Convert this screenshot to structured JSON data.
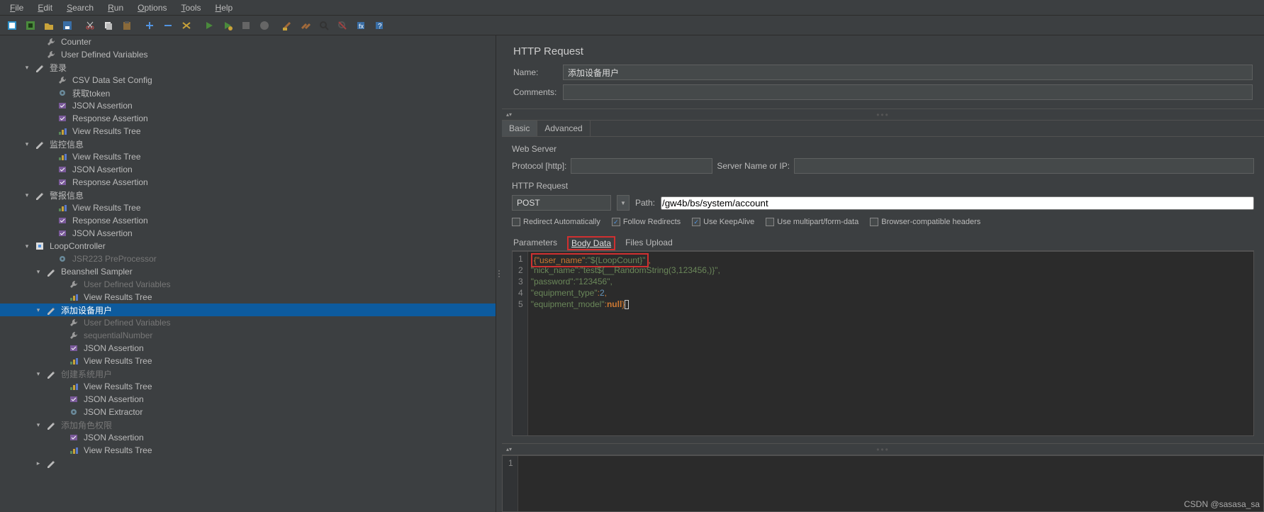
{
  "menu": {
    "items": [
      "File",
      "Edit",
      "Search",
      "Run",
      "Options",
      "Tools",
      "Help"
    ]
  },
  "toolbar_icons": [
    "new-test-plan",
    "template",
    "open",
    "save",
    "folder-open",
    "close",
    "",
    "cut",
    "copy",
    "paste",
    "",
    "plus",
    "minus",
    "wand",
    "",
    "run",
    "run-remote",
    "stop",
    "stop-all",
    "shutdown",
    "",
    "clear",
    "broom",
    "find",
    "log",
    "heap",
    "function",
    "help"
  ],
  "tree": [
    {
      "d": 3,
      "toggle": "",
      "icon": "wrench",
      "label": "Counter"
    },
    {
      "d": 3,
      "toggle": "",
      "icon": "wrench",
      "label": "User Defined Variables"
    },
    {
      "d": 2,
      "toggle": "▾",
      "icon": "pencil",
      "label": "登录"
    },
    {
      "d": 4,
      "toggle": "",
      "icon": "wrench",
      "label": "CSV Data Set Config"
    },
    {
      "d": 4,
      "toggle": "",
      "icon": "gear",
      "label": "获取token"
    },
    {
      "d": 4,
      "toggle": "",
      "icon": "assert",
      "label": "JSON Assertion"
    },
    {
      "d": 4,
      "toggle": "",
      "icon": "assert",
      "label": "Response Assertion"
    },
    {
      "d": 4,
      "toggle": "",
      "icon": "results",
      "label": "View Results Tree"
    },
    {
      "d": 2,
      "toggle": "▾",
      "icon": "pencil",
      "label": "监控信息"
    },
    {
      "d": 4,
      "toggle": "",
      "icon": "results",
      "label": "View Results Tree"
    },
    {
      "d": 4,
      "toggle": "",
      "icon": "assert",
      "label": "JSON Assertion"
    },
    {
      "d": 4,
      "toggle": "",
      "icon": "assert",
      "label": "Response Assertion"
    },
    {
      "d": 2,
      "toggle": "▾",
      "icon": "pencil",
      "label": "警报信息"
    },
    {
      "d": 4,
      "toggle": "",
      "icon": "results",
      "label": "View Results Tree"
    },
    {
      "d": 4,
      "toggle": "",
      "icon": "assert",
      "label": "Response Assertion"
    },
    {
      "d": 4,
      "toggle": "",
      "icon": "assert",
      "label": "JSON Assertion"
    },
    {
      "d": 2,
      "toggle": "▾",
      "icon": "loop",
      "label": "LoopController"
    },
    {
      "d": 4,
      "toggle": "",
      "icon": "gear",
      "label": "JSR223 PreProcessor",
      "dim": true
    },
    {
      "d": 3,
      "toggle": "▾",
      "icon": "pencil",
      "label": "Beanshell Sampler"
    },
    {
      "d": 5,
      "toggle": "",
      "icon": "wrench",
      "label": "User Defined Variables",
      "dim": true
    },
    {
      "d": 5,
      "toggle": "",
      "icon": "results",
      "label": "View Results Tree"
    },
    {
      "d": 3,
      "toggle": "▾",
      "icon": "pencil",
      "label": "添加设备用户",
      "selected": true
    },
    {
      "d": 5,
      "toggle": "",
      "icon": "wrench",
      "label": "User Defined Variables",
      "dim": true
    },
    {
      "d": 5,
      "toggle": "",
      "icon": "wrench",
      "label": "sequentialNumber",
      "dim": true
    },
    {
      "d": 5,
      "toggle": "",
      "icon": "assert",
      "label": "JSON Assertion"
    },
    {
      "d": 5,
      "toggle": "",
      "icon": "results",
      "label": "View Results Tree"
    },
    {
      "d": 3,
      "toggle": "▾",
      "icon": "pencil",
      "label": "创建系统用户",
      "dim": true
    },
    {
      "d": 5,
      "toggle": "",
      "icon": "results",
      "label": "View Results Tree"
    },
    {
      "d": 5,
      "toggle": "",
      "icon": "assert",
      "label": "JSON Assertion"
    },
    {
      "d": 5,
      "toggle": "",
      "icon": "gear",
      "label": "JSON Extractor"
    },
    {
      "d": 3,
      "toggle": "▾",
      "icon": "pencil",
      "label": "添加角色权限",
      "dim": true
    },
    {
      "d": 5,
      "toggle": "",
      "icon": "assert",
      "label": "JSON Assertion"
    },
    {
      "d": 5,
      "toggle": "",
      "icon": "results",
      "label": "View Results Tree"
    },
    {
      "d": 3,
      "toggle": "▸",
      "icon": "pencil",
      "label": "",
      "dim": true
    }
  ],
  "rp": {
    "title": "HTTP Request",
    "name_label": "Name:",
    "name_value": "添加设备用户",
    "comments_label": "Comments:",
    "comments_value": "",
    "tabs": {
      "basic": "Basic",
      "advanced": "Advanced"
    },
    "web_server_label": "Web Server",
    "protocol_label": "Protocol [http]:",
    "protocol_value": "",
    "server_label": "Server Name or IP:",
    "server_value": "",
    "http_req_label": "HTTP Request",
    "method_value": "POST",
    "path_label": "Path:",
    "path_value": "/gw4b/bs/system/account",
    "checks": {
      "redirect_auto": "Redirect Automatically",
      "follow_redirects": "Follow Redirects",
      "keepalive": "Use KeepAlive",
      "multipart": "Use multipart/form-data",
      "browser_compat": "Browser-compatible headers"
    },
    "body_tabs": {
      "params": "Parameters",
      "body": "Body Data",
      "files": "Files Upload"
    },
    "code": {
      "l1_a": "{\"user_name\"",
      "l1_b": ":\"${LoopCount}\"",
      "l1_c": ",",
      "l2": "\"nick_name\":\"test${__RandomString(3,123456,)}\",",
      "l3": "\"password\":\"123456\",",
      "l4_a": "\"equipment_type\"",
      "l4_b": ":",
      "l4_c": "2",
      "l4_d": ",",
      "l5_a": "\"equipment_model\"",
      "l5_b": ":",
      "l5_c": "null",
      "l5_d": "}"
    },
    "bottom_gutter": "1"
  },
  "watermark": "CSDN @sasasa_sa"
}
